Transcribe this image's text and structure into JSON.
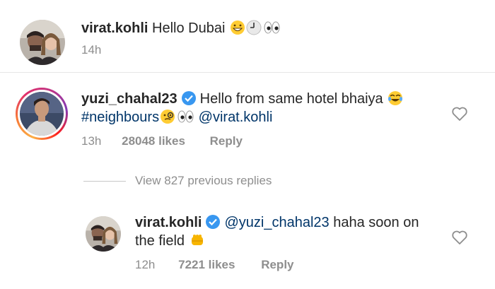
{
  "comments": [
    {
      "username": "virat.kohli",
      "text": "Hello Dubai",
      "emojis": [
        "grinning-face",
        "clock",
        "eyes"
      ],
      "time": "14h"
    },
    {
      "username": "yuzi_chahal23",
      "verified": true,
      "text": "Hello from same hotel bhaiya",
      "hashtag": "#neighbours",
      "mention": "@virat.kohli",
      "emojis": [
        "tears-of-joy",
        "monocle-face",
        "eyes"
      ],
      "time": "13h",
      "likes": "28048 likes",
      "reply_label": "Reply"
    }
  ],
  "view_replies": "View 827 previous replies",
  "reply": {
    "username": "virat.kohli",
    "verified": true,
    "mention": "@yuzi_chahal23",
    "text_line1": "haha soon on",
    "text_line2": "the field",
    "emojis": [
      "oncoming-fist"
    ],
    "time": "12h",
    "likes": "7221 likes",
    "reply_label": "Reply"
  },
  "colors": {
    "link": "#003569",
    "meta": "#8e8e8e",
    "verified": "#3897f0",
    "divider": "#e6e6e6"
  }
}
